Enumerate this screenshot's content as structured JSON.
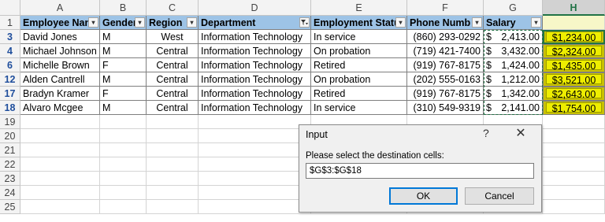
{
  "columns": [
    "A",
    "B",
    "C",
    "D",
    "E",
    "F",
    "G",
    "H"
  ],
  "selected_column": "H",
  "headers": [
    "Employee Nan",
    "Gender",
    "Region",
    "Department",
    "Employment Statu",
    "Phone Numb",
    "Salary"
  ],
  "filter_active_column": "D",
  "rows": [
    {
      "row": "3",
      "name": "David Jones",
      "gender": "M",
      "region": "West",
      "department": "Information Technology",
      "status": "In service",
      "phone": "(860) 293-0292",
      "salary_sym": "$",
      "salary": "2,413.00",
      "h": "$1,234.00"
    },
    {
      "row": "4",
      "name": "Michael Johnson",
      "gender": "M",
      "region": "Central",
      "department": "Information Technology",
      "status": "On probation",
      "phone": "(719) 421-7400",
      "salary_sym": "$",
      "salary": "3,432.00",
      "h": "$2,324.00"
    },
    {
      "row": "6",
      "name": "Michelle Brown",
      "gender": "F",
      "region": "Central",
      "department": "Information Technology",
      "status": "Retired",
      "phone": "(919) 767-8175",
      "salary_sym": "$",
      "salary": "1,424.00",
      "h": "$1,435.00"
    },
    {
      "row": "12",
      "name": "Alden Cantrell",
      "gender": "M",
      "region": "Central",
      "department": "Information Technology",
      "status": "On probation",
      "phone": "(202) 555-0163",
      "salary_sym": "$",
      "salary": "1,212.00",
      "h": "$3,521.00"
    },
    {
      "row": "17",
      "name": "Bradyn Kramer",
      "gender": "F",
      "region": "Central",
      "department": "Information Technology",
      "status": "Retired",
      "phone": "(919) 767-8175",
      "salary_sym": "$",
      "salary": "1,342.00",
      "h": "$2,643.00"
    },
    {
      "row": "18",
      "name": "Alvaro Mcgee",
      "gender": "M",
      "region": "Central",
      "department": "Information Technology",
      "status": "In service",
      "phone": "(310) 549-9319",
      "salary_sym": "$",
      "salary": "2,141.00",
      "h": "$1,754.00"
    }
  ],
  "empty_rows": [
    "19",
    "20",
    "21",
    "22",
    "23",
    "24",
    "25"
  ],
  "header_row_number": "1",
  "dialog": {
    "title": "Input",
    "help": "?",
    "close": "✕",
    "prompt": "Please select the destination cells:",
    "value": "$G$3:$G$18",
    "ok": "OK",
    "cancel": "Cancel"
  },
  "colors": {
    "header_fill": "#9dc3e6",
    "highlight_fill": "#eeee00",
    "highlight_column_fill": "#c9c100",
    "selected_header_accent": "#217346"
  }
}
